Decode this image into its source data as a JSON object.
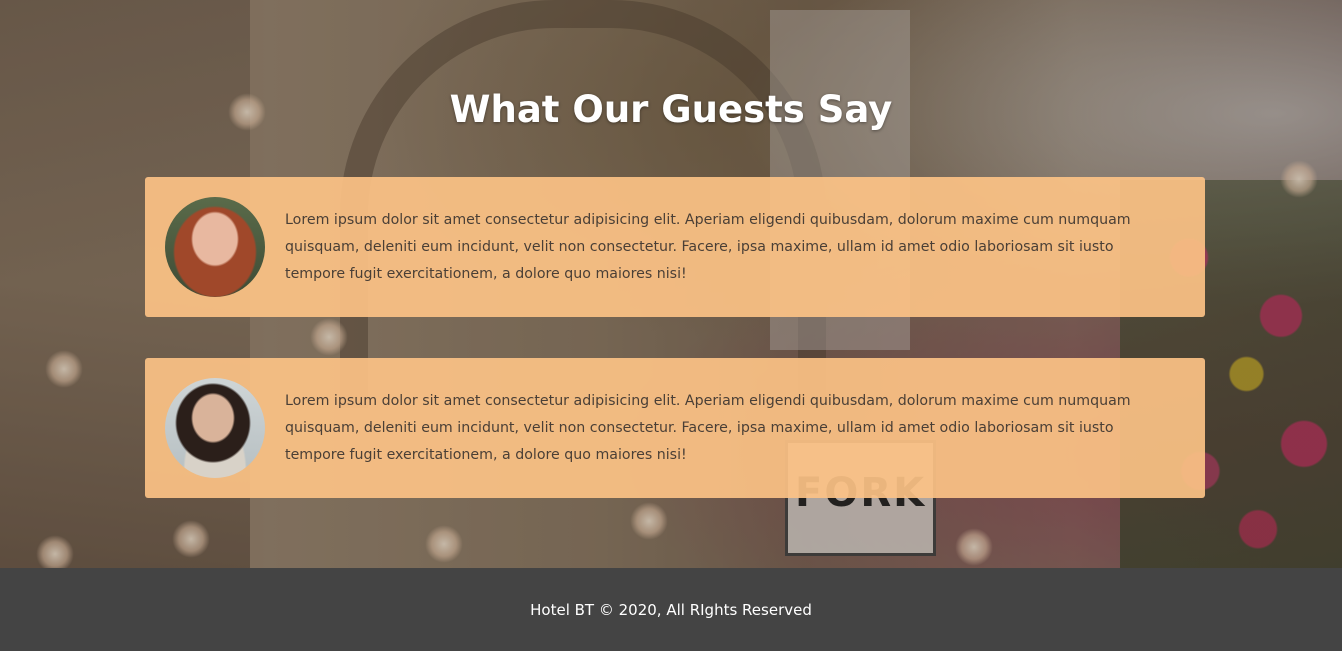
{
  "testimonials": {
    "title": "What Our Guests Say",
    "items": [
      {
        "avatar_icon": "woman-red-hair-avatar",
        "text": "Lorem ipsum dolor sit amet consectetur adipisicing elit. Aperiam eligendi quibusdam, dolorum maxime cum numquam quisquam, deleniti eum incidunt, velit non consectetur. Facere, ipsa maxime, ullam id amet odio laboriosam sit iusto tempore fugit exercitationem, a dolore quo maiores nisi!"
      },
      {
        "avatar_icon": "woman-dark-hair-avatar",
        "text": "Lorem ipsum dolor sit amet consectetur adipisicing elit. Aperiam eligendi quibusdam, dolorum maxime cum numquam quisquam, deleniti eum incidunt, velit non consectetur. Facere, ipsa maxime, ullam id amet odio laboriosam sit iusto tempore fugit exercitationem, a dolore quo maiores nisi!"
      }
    ]
  },
  "background": {
    "sign_text": "FORK"
  },
  "footer": {
    "text": "Hotel BT © 2020, All RIghts Reserved"
  },
  "colors": {
    "card": "#fcc286",
    "footer": "#444444",
    "title": "#ffffff",
    "quote_text": "#4a3f36"
  }
}
